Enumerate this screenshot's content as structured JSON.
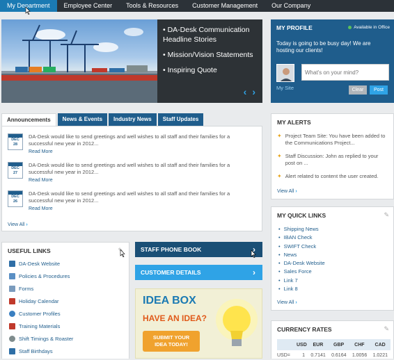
{
  "topnav": {
    "items": [
      "My Department",
      "Employee Center",
      "Tools & Resources",
      "Customer Management",
      "Our Company"
    ]
  },
  "hero": {
    "bullets": [
      "DA-Desk Communication Headline Stories",
      "Mission/Vision Statements",
      "Inspiring Quote"
    ],
    "prev": "‹",
    "next": "›"
  },
  "profile": {
    "title": "MY PROFILE",
    "status": "Available in Office",
    "message": "Today is going to be busy day! We are hosting our clients!",
    "input_placeholder": "What's on your mind?",
    "my_site": "My Site",
    "clear": "Clear",
    "post": "Post"
  },
  "tabs": [
    "Announcements",
    "News & Events",
    "Industry News",
    "Staff Updates"
  ],
  "announcements": {
    "items": [
      {
        "month": "DEC",
        "day": "28",
        "text": "DA-Desk would like to send greetings and well wishes to all staff and their families for a successful new year in 2012...",
        "more": "Read More"
      },
      {
        "month": "DEC",
        "day": "27",
        "text": "DA-Desk would like to send greetings and well wishes to all staff and their families for a successful new year in 2012...",
        "more": "Read More"
      },
      {
        "month": "DEC",
        "day": "26",
        "text": "DA-Desk would like to send greetings and well wishes to all staff and their families for a successful new year in 2012...",
        "more": "Read More"
      }
    ],
    "view_all": "View All"
  },
  "alerts": {
    "title": "MY ALERTS",
    "items": [
      "Project Team Site: You have been added to the Communications Project...",
      "Staff Discussion: John as replied to your post on ...",
      "Alert related to content the user created."
    ],
    "view_all": "View All"
  },
  "quick_links": {
    "title": "MY QUICK LINKS",
    "items": [
      "Shipping News",
      "IBAN Check",
      "SWIFT Check",
      "News",
      "DA-Desk Website",
      "Sales Force",
      "Link 7",
      "Link 8"
    ],
    "view_all": "View All"
  },
  "useful_links": {
    "title": "USEFUL LINKS",
    "items": [
      "DA-Desk Website",
      "Policies & Procedures",
      "Forms",
      "Holiday Calendar",
      "Customer Profiles",
      "Training Materials",
      "Shift Timings & Roaster",
      "Staff Birthdays"
    ],
    "icon_colors": [
      "#2e6ea6",
      "#5a8fc4",
      "#7a9bbd",
      "#c0392b",
      "#3a7fc1",
      "#c0392b",
      "#7f8c8d",
      "#2e6ea6"
    ]
  },
  "buttons": {
    "staff_phone_book": "STAFF PHONE BOOK",
    "customer_details": "CUSTOMER DETAILS"
  },
  "idea_box": {
    "title": "IDEA BOX",
    "subtitle": "HAVE AN IDEA?",
    "cta_line1": "SUBMIT YOUR",
    "cta_line2": "IDEA TODAY!"
  },
  "currency": {
    "title": "CURRENCY RATES",
    "headers": [
      "",
      "USD",
      "EUR",
      "GBP",
      "CHF",
      "CAD"
    ],
    "row": [
      "USD=",
      "1",
      "0.7141",
      "0.6164",
      "1.0056",
      "1.0221"
    ]
  },
  "colors": {
    "nav_bg": "#2c3238",
    "nav_active": "#1b7ab3",
    "primary_dark": "#1f5d8c",
    "staff_btn": "#1a4f76",
    "customer_btn": "#2fa3e6",
    "idea_orange": "#f0a22e"
  }
}
